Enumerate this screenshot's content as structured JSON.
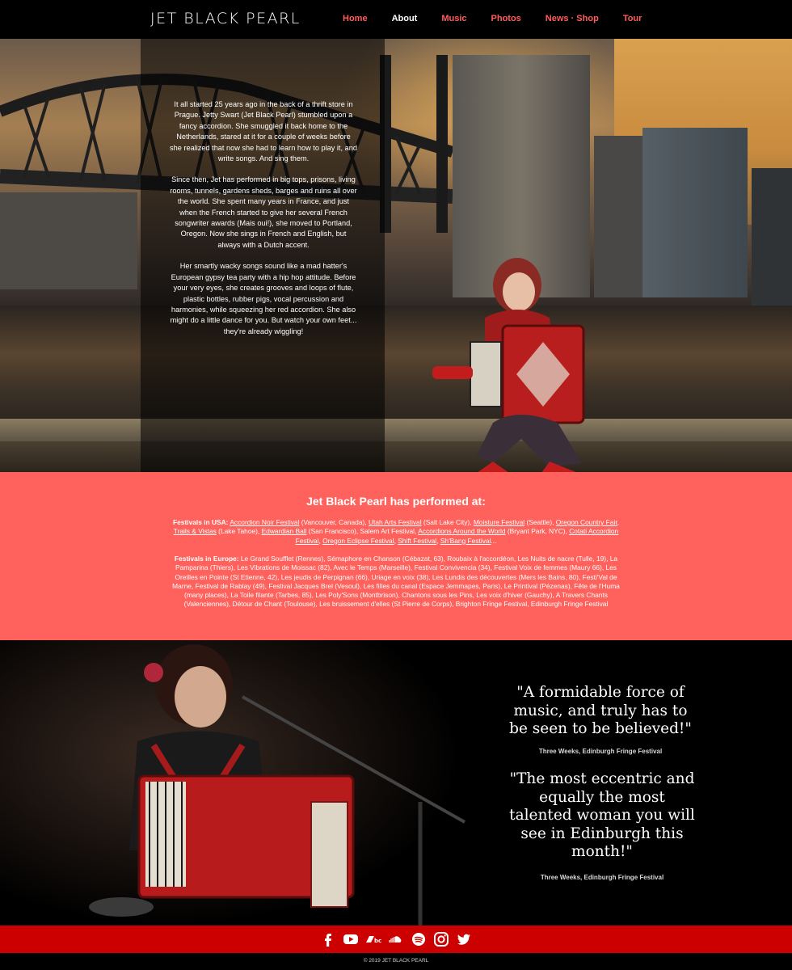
{
  "header": {
    "logo": "JET BLACK PEARL",
    "nav": [
      {
        "label": "Home",
        "active": false
      },
      {
        "label": "About",
        "active": true
      },
      {
        "label": "Music",
        "active": false
      },
      {
        "label": "Photos",
        "active": false
      },
      {
        "label": "News · Shop",
        "active": false
      },
      {
        "label": "Tour",
        "active": false
      }
    ]
  },
  "bio": {
    "p1": "It all started 25 years ago in the back of a thrift store in Prague. Jetty Swart (Jet Black Pearl) stumbled upon a fancy accordion. She smuggled it back home to the Netherlands, stared at it for a couple of weeks before she realized that now she had to learn how to play it, and write songs. And sing them.",
    "p2": "Since then, Jet has performed in big tops, prisons, living rooms, tunnels, gardens sheds, barges and ruins all over the world. She spent many years in France, and just when the French started to give her several French songwriter awards (Mais oui!), she moved to Portland, Oregon. Now she sings in French and English, but always with a Dutch accent.",
    "p3": "Her smartly wacky songs sound like a mad hatter's European gypsy tea party with a hip hop attitude. Before your very eyes, she creates grooves and loops of flute, plastic bottles, rubber pigs, vocal percussion and harmonies, while squeezing her red accordion. She also might do a little dance for you. But watch your own feet... they're already wiggling!"
  },
  "festivals": {
    "title": "Jet Black Pearl has performed at:",
    "usa_label": "Festivals in USA:",
    "usa": [
      {
        "name": "Accordion Noir Festival",
        "link": true,
        "after": " (Vancouver, Canada), "
      },
      {
        "name": "Utah Arts Festival",
        "link": true,
        "after": " (Salt Lake City), "
      },
      {
        "name": "Moisture Festival",
        "link": true,
        "after": " (Seattle), "
      },
      {
        "name": "Oregon Country Fair",
        "link": true,
        "after": ", "
      },
      {
        "name": "Trails & Vistas",
        "link": true,
        "after": " (Lake Tahoe), "
      },
      {
        "name": "Edwardian Ball",
        "link": true,
        "after": " (San Francisco), Salem Art Festival, "
      },
      {
        "name": "Accordions Around the World",
        "link": true,
        "after": " (Bryant Park, NYC), "
      },
      {
        "name": "Cotati Accordion Festival",
        "link": true,
        "after": ", "
      },
      {
        "name": "Oregon Eclipse Festival",
        "link": true,
        "after": ", "
      },
      {
        "name": "Shift Festival",
        "link": true,
        "after": ", "
      },
      {
        "name": "Sh'Bang Festival",
        "link": true,
        "after": "..."
      }
    ],
    "europe_label": "Festivals in Europe:",
    "europe": "Le Grand Soufflet (Rennes), Sémaphore en Chanson (Cébazat, 63), Roubaix à l'accordéon, Les Nuits de nacre (Tulle, 19), La Pamparina (Thiers), Les Vibrations de Moissac (82), Avec le Temps (Marseille), Festival Convivencia (34), Festival Voix de femmes (Maury 66), Les Oreilles en Pointe (St Etienne, 42), Les jeudis de Perpignan (66), Uriage en voix (38), Les Lundis des découvertes (Mers les Bains, 80), Festi'Val de Marne, Festival de Rablay (49), Festival Jacques Brel (Vesoul), Les filles du canal (Espace Jemmapes, Paris), Le Printival (Pézenas), Fête de l'Huma (many places), La Toile filante (Tarbes, 85), Les Poly'Sons (Montbrison), Chantons sous les Pins, Les voix d'hiver (Gauchy), A Travers Chants (Valenciennes), Détour de Chant (Toulouse), Les bruissement d'elles (St Pierre de Corps), Brighton Fringe Festival, Edinburgh Fringe Festival"
  },
  "quotes": [
    {
      "text": "\"A formidable force of music, and truly has to be seen to be believed!\"",
      "source": "Three Weeks, Edinburgh Fringe Festival"
    },
    {
      "text": "\"The most eccentric and equally the most talented woman you will see in Edinburgh this month!\"",
      "source": "Three Weeks, Edinburgh Fringe Festival"
    }
  ],
  "social": [
    "facebook-icon",
    "youtube-icon",
    "bandcamp-icon",
    "soundcloud-icon",
    "spotify-icon",
    "instagram-icon",
    "twitter-icon"
  ],
  "footer": {
    "copyright": "© 2019 JET BLACK PEARL"
  },
  "colors": {
    "accent": "#ff625c",
    "nav_link": "#ff5c5c",
    "social_bar": "#cc0000"
  }
}
